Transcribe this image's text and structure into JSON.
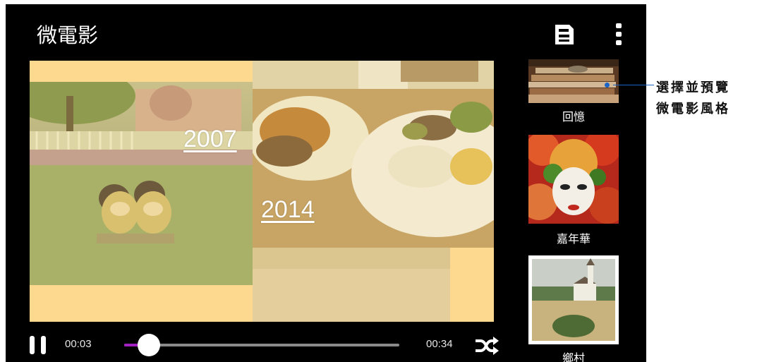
{
  "app": {
    "title": "微電影"
  },
  "toolbar": {
    "save_icon": "save-icon",
    "more_icon": "more-vert-icon"
  },
  "preview": {
    "years": [
      "2007",
      "2014"
    ]
  },
  "player": {
    "current_time": "00:03",
    "total_time": "00:34",
    "progress": 0.09,
    "pause_icon": "pause-icon",
    "shuffle_icon": "shuffle-icon"
  },
  "styles": [
    {
      "label": "回憶"
    },
    {
      "label": "嘉年華"
    },
    {
      "label": "鄉村"
    }
  ],
  "callout": {
    "line1": "選擇並預覽",
    "line2": "微電影風格"
  },
  "colors": {
    "accent": "#a020c0",
    "callout_line": "#1a63c7",
    "frame": "#000000",
    "overlay": "#fdd88f"
  }
}
